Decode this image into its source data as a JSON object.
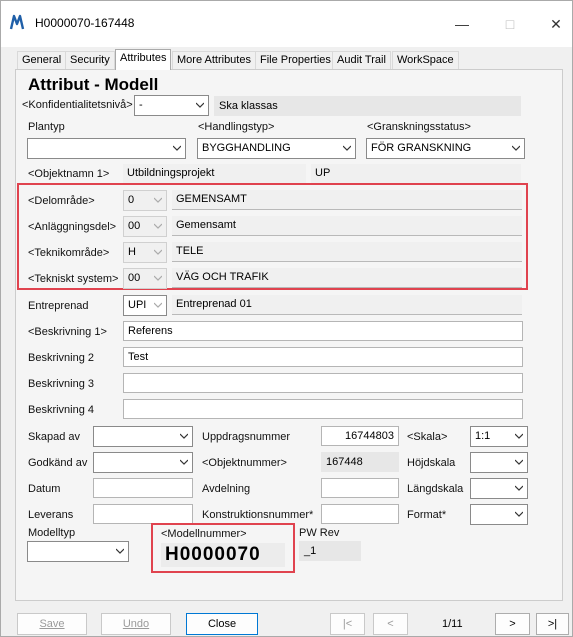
{
  "window": {
    "title": "H0000070-167448"
  },
  "tabs": [
    "General",
    "Security",
    "Attributes",
    "More Attributes",
    "File Properties",
    "Audit Trail",
    "WorkSpace"
  ],
  "active_tab": "Attributes",
  "heading": "Attribut - Modell",
  "konfidentialitet": {
    "label": "<Konfidentialitetsnivå>",
    "value": "-",
    "text": "Ska klassas"
  },
  "plantyp": {
    "label": "Plantyp",
    "value": ""
  },
  "handlingstyp": {
    "label": "<Handlingstyp>",
    "value": "BYGGHANDLING"
  },
  "granskningsstatus": {
    "label": "<Granskningsstatus>",
    "value": "FÖR GRANSKNING"
  },
  "objektnamn": {
    "label": "<Objektnamn 1>",
    "value": "Utbildningsprojekt",
    "code": "UP"
  },
  "delomrade": {
    "label": "<Delområde>",
    "code": "0",
    "text": "GEMENSAMT"
  },
  "anlaggningsdel": {
    "label": "<Anläggningsdel>",
    "code": "00",
    "text": "Gemensamt"
  },
  "teknikomrade": {
    "label": "<Teknikområde>",
    "code": "H",
    "text": "TELE"
  },
  "tekniskt_system": {
    "label": "<Tekniskt system>",
    "code": "00",
    "text": "VÄG OCH TRAFIK"
  },
  "entreprenad": {
    "label": "Entreprenad",
    "code": "UPI",
    "text": "Entreprenad 01"
  },
  "beskrivning1": {
    "label": "<Beskrivning 1>",
    "value": "Referens"
  },
  "beskrivning2": {
    "label": "Beskrivning 2",
    "value": "Test"
  },
  "beskrivning3": {
    "label": "Beskrivning 3",
    "value": ""
  },
  "beskrivning4": {
    "label": "Beskrivning 4",
    "value": ""
  },
  "skapad_av": {
    "label": "Skapad av",
    "value": ""
  },
  "godkand_av": {
    "label": "Godkänd av",
    "value": ""
  },
  "datum": {
    "label": "Datum",
    "value": ""
  },
  "leverans": {
    "label": "Leverans",
    "value": ""
  },
  "uppdragsnummer": {
    "label": "Uppdragsnummer",
    "value": "16744803"
  },
  "objektnummer": {
    "label": "<Objektnummer>",
    "value": "167448"
  },
  "avdelning": {
    "label": "Avdelning",
    "value": ""
  },
  "konstruktionsnummer": {
    "label": "Konstruktionsnummer*",
    "value": ""
  },
  "skala": {
    "label": "<Skala>",
    "value": "1:1"
  },
  "hojdskala": {
    "label": "Höjdskala",
    "value": ""
  },
  "langdskala": {
    "label": "Längdskala",
    "value": ""
  },
  "format": {
    "label": "Format*",
    "value": ""
  },
  "modelltyp": {
    "label": "Modelltyp",
    "value": ""
  },
  "modellnummer": {
    "label": "<Modellnummer>",
    "value": "H0000070"
  },
  "pw_rev": {
    "label": "PW Rev",
    "value": "_1"
  },
  "buttons": {
    "save": "Save",
    "undo": "Undo",
    "close": "Close",
    "first": "|<",
    "prev": "<",
    "page": "1/11",
    "next": ">",
    "last": ">|"
  },
  "colors": {
    "highlight_border": "#e0434f",
    "accent": "#0078d4"
  }
}
